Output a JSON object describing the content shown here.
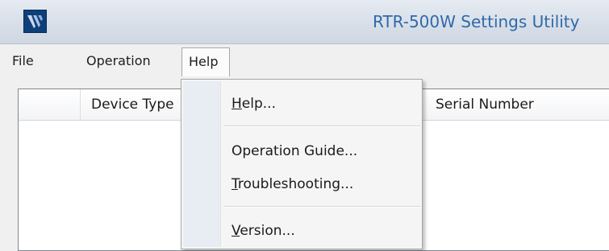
{
  "window": {
    "title": "RTR-500W Settings Utility",
    "app_icon": "rtr-app-logo"
  },
  "menubar": {
    "items": [
      {
        "label": "File"
      },
      {
        "label": "Operation"
      },
      {
        "label": "Help",
        "active": true
      }
    ]
  },
  "device_list": {
    "columns": [
      "",
      "Device Type",
      "Serial Number"
    ]
  },
  "help_menu": {
    "items": [
      {
        "mnemonic": "H",
        "rest": "elp..."
      },
      {
        "label": "Operation Guide..."
      },
      {
        "mnemonic": "T",
        "rest": "roubleshooting..."
      },
      {
        "mnemonic": "V",
        "rest": "ersion..."
      }
    ]
  },
  "colors": {
    "title_text": "#2f6aa8",
    "titlebar_bg": "#dbe1ea",
    "menu_bg": "#f5f5f5",
    "menu_gutter": "#e8edf3"
  }
}
